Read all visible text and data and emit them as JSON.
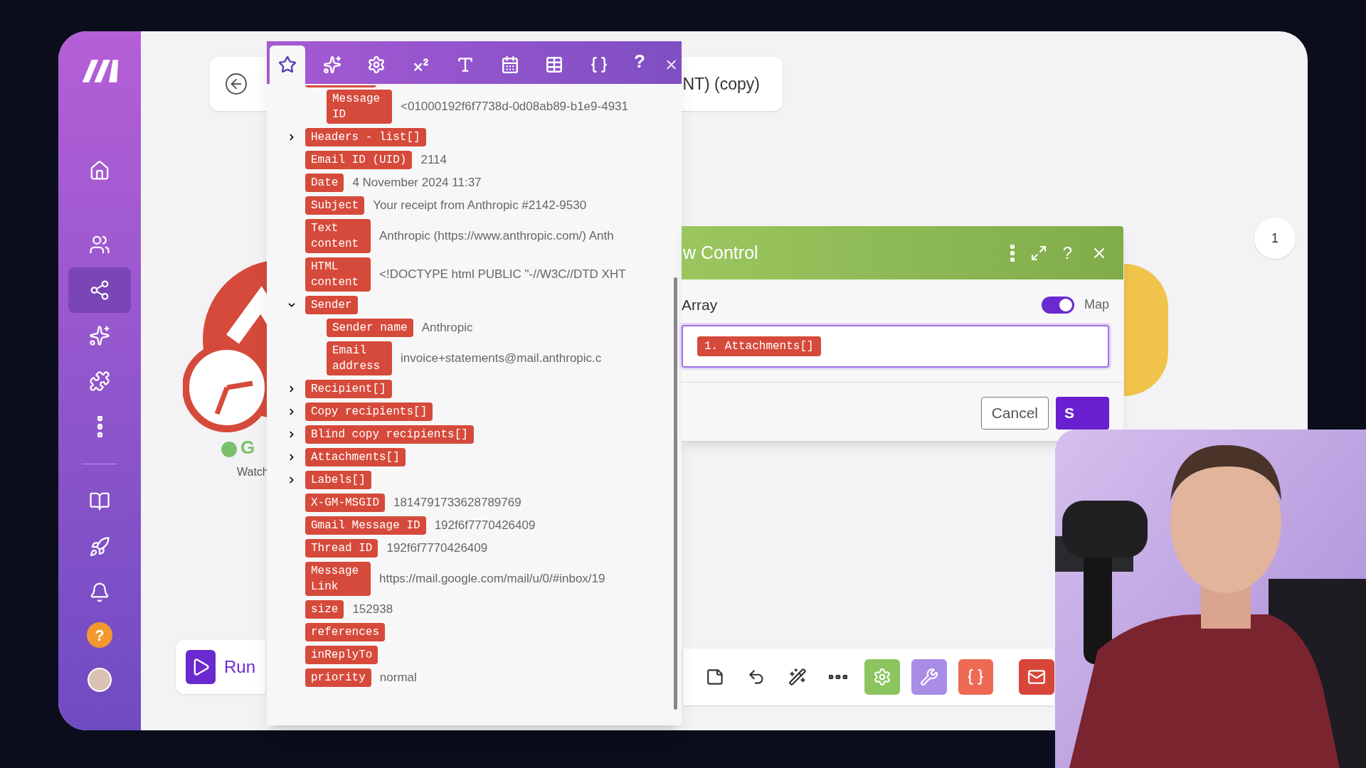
{
  "sidebar": {
    "items": [
      {
        "selected": false
      },
      {
        "selected": false
      },
      {
        "selected": true
      },
      {
        "selected": false
      },
      {
        "selected": false
      },
      {
        "selected": false
      },
      {
        "selected": false
      },
      {
        "selected": false
      },
      {
        "selected": false
      }
    ],
    "help": "?"
  },
  "top_bar": {
    "title": "NT) (copy)"
  },
  "canvas": {
    "module_label": "G",
    "module_sublabel": "Watch",
    "bubble": "1"
  },
  "run_button": {
    "label": "Run"
  },
  "mapping_panel": {
    "tabs": [
      {
        "selected": true
      },
      {
        "selected": false
      },
      {
        "selected": false
      },
      {
        "selected": false
      },
      {
        "selected": false
      },
      {
        "selected": false
      },
      {
        "selected": false
      },
      {
        "selected": false
      }
    ],
    "help": "?",
    "items": [
      {
        "children": [
          {
            "label": "Message ID",
            "value": "<01000192f6f7738d-0d08ab89-b1e9-4931",
            "kind": "wide"
          }
        ]
      },
      {
        "label": "Headers - list[]",
        "expanded": false
      },
      {
        "label": "Email ID (UID)",
        "value": "2114",
        "kind": "short"
      },
      {
        "label": "Date",
        "value": "4 November 2024 11:37",
        "kind": "short"
      },
      {
        "label": "Subject",
        "value": "Your receipt from Anthropic #2142-9530",
        "kind": "short"
      },
      {
        "label": "Text content",
        "value": "Anthropic (https://www.anthropic.com/) Anth",
        "kind": "wide"
      },
      {
        "label": "HTML content",
        "value": "<!DOCTYPE html PUBLIC \"-//W3C//DTD XHT",
        "kind": "wide"
      },
      {
        "label": "Sender",
        "expanded": true,
        "children": [
          {
            "label": "Sender name",
            "value": "Anthropic",
            "kind": "short"
          },
          {
            "label": "Email address",
            "value": "invoice+statements@mail.anthropic.c",
            "kind": "wide"
          }
        ]
      },
      {
        "label": "Recipient[]",
        "expanded": false
      },
      {
        "label": "Copy recipients[]",
        "expanded": false
      },
      {
        "label": "Blind copy recipients[]",
        "expanded": false
      },
      {
        "label": "Attachments[]",
        "expanded": false
      },
      {
        "label": "Labels[]",
        "expanded": false
      },
      {
        "label": "X-GM-MSGID",
        "value": "1814791733628789769",
        "kind": "short"
      },
      {
        "label": "Gmail Message ID",
        "value": "192f6f7770426409",
        "kind": "short"
      },
      {
        "label": "Thread ID",
        "value": "192f6f7770426409",
        "kind": "short"
      },
      {
        "label": "Message Link",
        "value": "https://mail.google.com/mail/u/0/#inbox/19",
        "kind": "wide"
      },
      {
        "label": "size",
        "value": "152938",
        "kind": "short"
      },
      {
        "label": "references",
        "kind": "short"
      },
      {
        "label": "inReplyTo",
        "kind": "short"
      },
      {
        "label": "priority",
        "value": "normal",
        "kind": "short"
      }
    ]
  },
  "dialog": {
    "title": "w Control",
    "help": "?",
    "field_label": "Array",
    "map_toggle": {
      "label": "Map",
      "on": true
    },
    "chips": [
      "1. Attachments[]"
    ],
    "cancel": "Cancel",
    "save": "S"
  },
  "toolbar": {
    "modules": [
      {
        "color": "#8cc460"
      },
      {
        "color": "#a98ce6"
      },
      {
        "color": "#ee6a55"
      },
      {
        "color": "#d8463a"
      }
    ]
  }
}
